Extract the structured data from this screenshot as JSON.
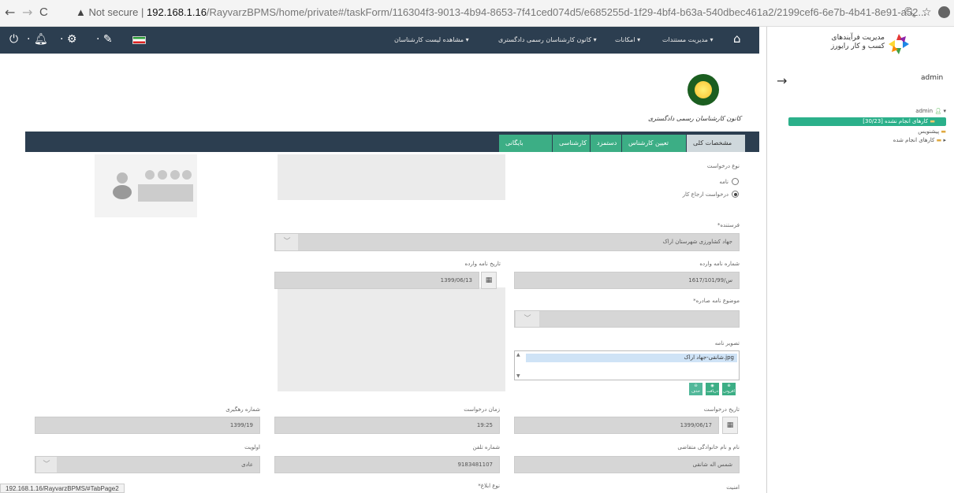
{
  "browser": {
    "back": "←",
    "forward": "→",
    "reload": "C",
    "not_secure": "Not secure",
    "separator": "|",
    "url_host": "192.168.1.16",
    "url_path": "/RayvarzBPMS/home/private#/taskForm/116304f3-9013-4b94-8653-7f41ced074d5/e685255d-1f29-4bf4-b63a-540dbec461a2/2199cef6-6e7b-4b41-8e91-a52..."
  },
  "header": {
    "menu_home": "مدیریت مستندات",
    "menu_features": "امکانات",
    "menu_court": "کانون کارشناسان رسمی دادگستری",
    "menu_list": "مشاهده لیست کارشناسان"
  },
  "right_panel": {
    "logo_line1": "مدیریت فرآیندهای",
    "logo_line2": "کسب و کار رایورز",
    "user": "admin",
    "tree_root": "admin",
    "tree_pending": "کارهای انجام نشده [30/23]",
    "tree_drafts": "پیشنویس",
    "tree_done": "کارهای انجام شده"
  },
  "org": {
    "title": "کانون کارشناسان رسمی دادگستری"
  },
  "tabs": [
    "مشخصات کلی",
    "تعیین کارشناس",
    "دستمزد",
    "کارشناسی",
    "بایگانی"
  ],
  "form": {
    "request_type_label": "نوع درخواست",
    "opt_letter": "نامه",
    "opt_referral": "درخواست ارجاع کار",
    "sender_label": "*فرستنده",
    "sender_value": "جهاد کشاورزی شهرستان اراک",
    "incoming_no_label": "شماره نامه وارده",
    "incoming_no_value": "س/1617/101/99",
    "incoming_date_label": "تاریخ نامه وارده",
    "incoming_date_value": "1399/06/13",
    "subject_label": "*موضوع نامه صادره",
    "image_label": "تصویر نامه",
    "image_file": "شانقی-جهاد اراک.jpg",
    "btn_add": "افزودن",
    "btn_get": "دریافت",
    "btn_delete": "حذف",
    "req_date_label": "تاریخ درخواست",
    "req_date_value": "1399/06/17",
    "req_time_label": "زمان درخواست",
    "req_time_value": "19:25",
    "tracking_label": "شماره رهگیری",
    "tracking_value": "1399/19",
    "applicant_label": "نام و نام خانوادگی متقاضی",
    "applicant_value": "شمس اله شانقی",
    "phone_label": "شماره تلفن",
    "phone_value": "9183481107",
    "priority_label": "اولویت",
    "priority_value": "عادی",
    "security_label": "امنیت",
    "notify_label": "*نوع ابلاغ"
  },
  "status_bar": "192.168.1.16/RayvarzBPMS/#TabPage2"
}
